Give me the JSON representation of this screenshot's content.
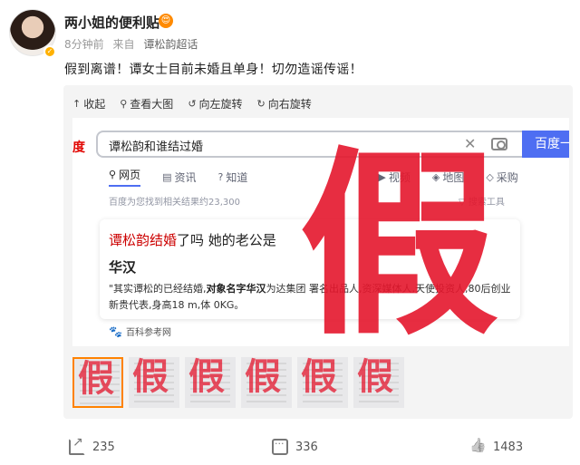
{
  "post": {
    "username": "两小姐的便利贴",
    "vip_badge": "😍",
    "time": "8分钟前",
    "source_prefix": "来自",
    "source": "谭松韵超话",
    "text": "假到离谱！谭女士目前未婚且单身！切勿造谣传谣！"
  },
  "media_toolbar": {
    "collapse_label": "收起",
    "view_large_label": "查看大图",
    "rotate_left_label": "向左旋转",
    "rotate_right_label": "向右旋转"
  },
  "screenshot": {
    "logo": "度",
    "query": "谭松韵和谁结过婚",
    "search_button": "百度一",
    "tabs": [
      {
        "label": "网页",
        "icon": "search-icon"
      },
      {
        "label": "资讯",
        "icon": "news-icon"
      },
      {
        "label": "知道",
        "icon": "question-icon"
      },
      {
        "label": "视频",
        "icon": "video-icon"
      },
      {
        "label": "地图",
        "icon": "map-icon"
      },
      {
        "label": "采购",
        "icon": "shopping-icon"
      }
    ],
    "result_count": "百度为您找到相关结果约23,300",
    "search_tools": "▽ 搜索工具",
    "card_title_highlight": "谭松韵结婚",
    "card_title_rest": "了吗 她的老公是",
    "card_answer": "华汉",
    "card_snippet_pre": "\"其实谭松的已经结婚,",
    "card_snippet_bold": "对象名字华汉",
    "card_snippet_post": "为达集团 署名出品人,资深媒体人,天使投资人,80后创业新贵代表,身高18 m,体 0KG。",
    "source_label": "百科参考网",
    "stamp": "假"
  },
  "thumbnails": [
    {
      "mark": "假",
      "active": true
    },
    {
      "mark": "假",
      "active": false
    },
    {
      "mark": "假",
      "active": false
    },
    {
      "mark": "假",
      "active": false
    },
    {
      "mark": "假",
      "active": false
    },
    {
      "mark": "假",
      "active": false
    }
  ],
  "actions": {
    "repost_count": "235",
    "comment_count": "336",
    "like_count": "1483"
  },
  "colors": {
    "stamp_red": "#e4162c",
    "baidu_blue": "#4e6ef2",
    "active_thumb_border": "#ff8200"
  }
}
